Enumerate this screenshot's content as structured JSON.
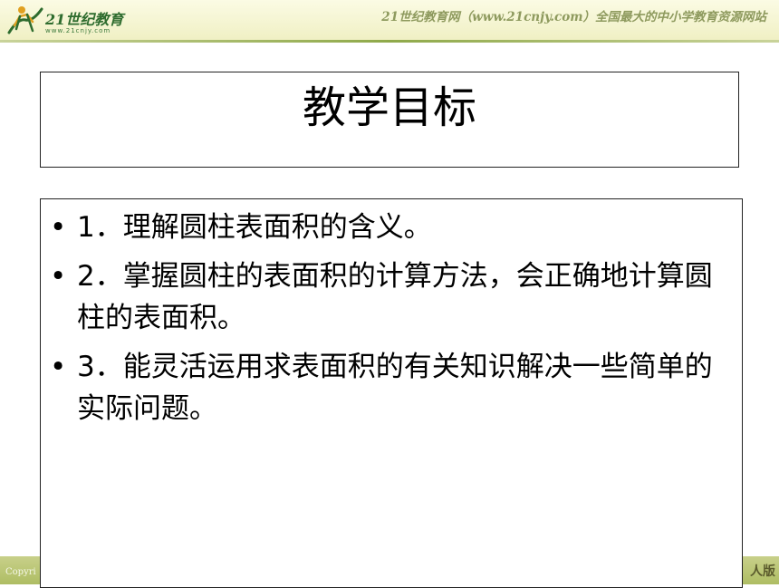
{
  "header": {
    "logo_text": "21世纪教育",
    "logo_url": "www.21cnjy.com",
    "slogan": "21世纪教育网（www.21cnjy.com）全国最大的中小学教育资源网站"
  },
  "title": "教学目标",
  "objectives": [
    "1．理解圆柱表面积的含义。",
    "2．掌握圆柱的表面积的计算方法，会正确地计算圆柱的表面积。",
    "3．能灵活运用求表面积的有关知识解决一些简单的实际问题。"
  ],
  "footer": {
    "left_text": "Copyri",
    "right_text": "人版"
  },
  "colors": {
    "header_bg": "#f0f0c4",
    "footer_bg": "#b5c36e",
    "logo_green": "#2e6c2e"
  },
  "icons": {
    "logo": "running-figure-logo-icon",
    "bullet": "bullet-dot-icon"
  }
}
